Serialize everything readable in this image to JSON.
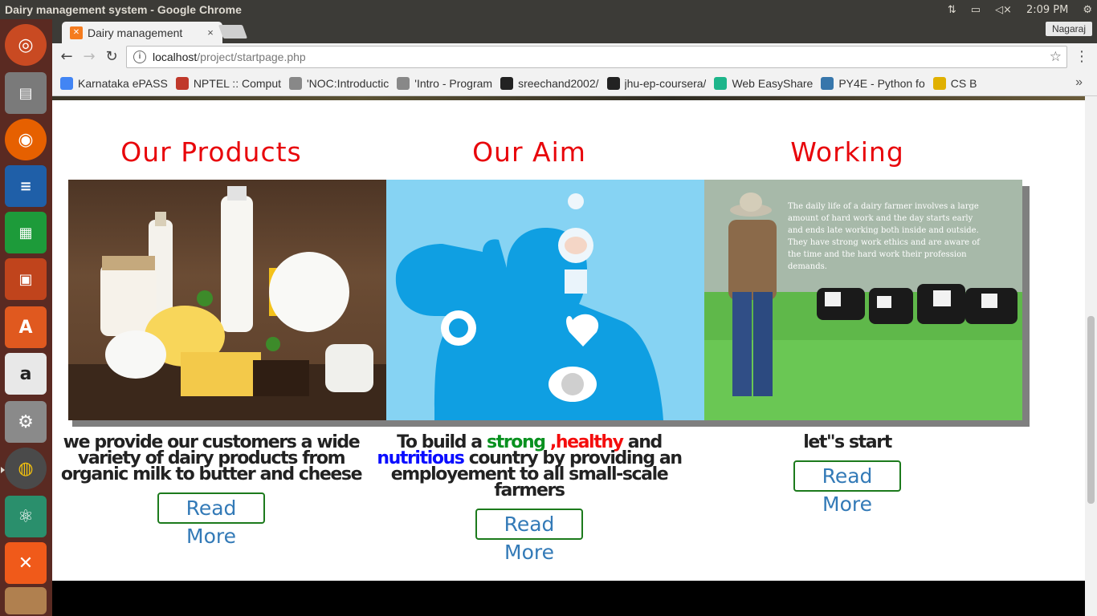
{
  "os": {
    "window_title": "Dairy management system - Google Chrome",
    "clock": "2:09 PM",
    "indicators": [
      "network-arrows-icon",
      "battery-icon",
      "volume-muted-icon",
      "settings-gear-icon"
    ]
  },
  "launcher": {
    "apps": [
      "ubuntu-dash-icon",
      "files-icon",
      "firefox-icon",
      "writer-icon",
      "calc-icon",
      "impress-icon",
      "software-center-icon",
      "amazon-icon",
      "system-settings-icon",
      "chrome-icon",
      "atom-icon",
      "xampp-icon",
      "trash-icon"
    ]
  },
  "browser": {
    "tab_title": "Dairy management",
    "tab_close": "×",
    "profile_name": "Nagaraj",
    "url_host": "localhost",
    "url_path": "/project/startpage.php",
    "bookmarks": [
      {
        "label": "Karnataka ePASS",
        "icon": "google-icon",
        "color": "#4285f4"
      },
      {
        "label": "NPTEL :: Comput",
        "icon": "nptel-icon",
        "color": "#c0392b"
      },
      {
        "label": "'NOC:Introductic",
        "icon": "page-icon",
        "color": "#888888"
      },
      {
        "label": "'Intro - Program",
        "icon": "page-icon",
        "color": "#888888"
      },
      {
        "label": "sreechand2002/",
        "icon": "github-icon",
        "color": "#222222"
      },
      {
        "label": "jhu-ep-coursera/",
        "icon": "github-icon",
        "color": "#222222"
      },
      {
        "label": "Web EasyShare",
        "icon": "easyshare-icon",
        "color": "#1db58a"
      },
      {
        "label": "PY4E - Python fo",
        "icon": "python-icon",
        "color": "#3776ab"
      },
      {
        "label": "CS B",
        "icon": "csb-icon",
        "color": "#e0b000"
      }
    ],
    "bookmarks_more": "»"
  },
  "page": {
    "columns": [
      {
        "heading": "Our Products",
        "image_alt": "dairy products",
        "description": "we provide our customers a wide variety of dairy products from organic milk to butter and cheese",
        "button": "Read More"
      },
      {
        "heading": "Our Aim",
        "image_alt": "healthy body illustration",
        "desc_parts": [
          "To build a ",
          "strong",
          " ,",
          "healthy",
          " and ",
          "nutritious",
          " country by providing an employement to all small-scale farmers"
        ],
        "button": "Read More"
      },
      {
        "heading": "Working",
        "image_alt": "dairy farmer with cows",
        "image_caption": "The daily life of a dairy farmer involves a large amount of hard work and the day starts early and ends late working both inside and outside. They have strong work ethics and are aware of the time and the hard work their profession demands.",
        "description": "let\"s start",
        "button": "Read More"
      }
    ]
  }
}
